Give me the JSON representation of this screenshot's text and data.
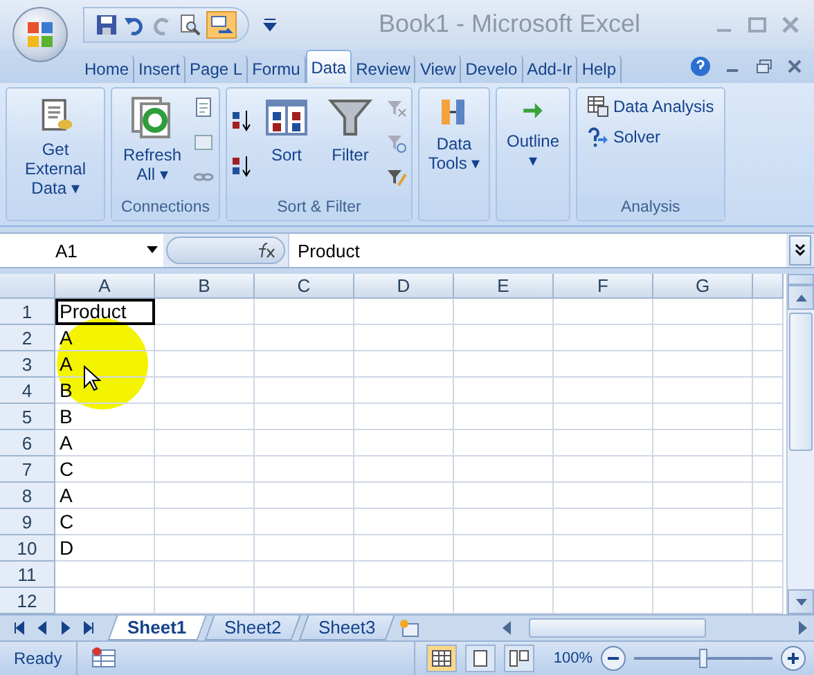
{
  "window": {
    "title": "Book1 - Microsoft Excel"
  },
  "tabs": [
    {
      "label": "Home",
      "selected": false
    },
    {
      "label": "Insert",
      "selected": false
    },
    {
      "label": "Page L",
      "selected": false
    },
    {
      "label": "Formu",
      "selected": false
    },
    {
      "label": "Data",
      "selected": true
    },
    {
      "label": "Review",
      "selected": false
    },
    {
      "label": "View",
      "selected": false
    },
    {
      "label": "Develo",
      "selected": false
    },
    {
      "label": "Add-Ir",
      "selected": false
    },
    {
      "label": "Help",
      "selected": false
    }
  ],
  "ribbon_groups": [
    {
      "buttons": [
        {
          "kind": "large",
          "label": "Get External Data ▾"
        }
      ]
    },
    {
      "label": "Connections",
      "buttons": [
        {
          "kind": "large",
          "label": "Refresh All ▾"
        },
        {
          "kind": "stack"
        }
      ]
    },
    {
      "label": "Sort & Filter",
      "buttons": [
        {
          "kind": "sortpair"
        },
        {
          "kind": "large",
          "label": "Sort"
        },
        {
          "kind": "large",
          "label": "Filter"
        },
        {
          "kind": "stack"
        }
      ]
    },
    {
      "buttons": [
        {
          "kind": "large",
          "label": "Data Tools ▾"
        }
      ]
    },
    {
      "buttons": [
        {
          "kind": "large",
          "label": "Outline ▾"
        }
      ]
    },
    {
      "label": "Analysis",
      "buttons": [
        {
          "kind": "small",
          "label": "Data Analysis"
        },
        {
          "kind": "small",
          "label": "Solver"
        }
      ]
    }
  ],
  "formula_bar": {
    "name_box": "A1",
    "formula": "Product"
  },
  "columns": [
    "A",
    "B",
    "C",
    "D",
    "E",
    "F",
    "G"
  ],
  "rows": [
    {
      "header": "1",
      "value": "Product",
      "selected": true
    },
    {
      "header": "2",
      "value": "A",
      "selected": false
    },
    {
      "header": "3",
      "value": "A",
      "selected": false
    },
    {
      "header": "4",
      "value": "B",
      "selected": false
    },
    {
      "header": "5",
      "value": "B",
      "selected": false
    },
    {
      "header": "6",
      "value": "A",
      "selected": false
    },
    {
      "header": "7",
      "value": "C",
      "selected": false
    },
    {
      "header": "8",
      "value": "A",
      "selected": false
    },
    {
      "header": "9",
      "value": "C",
      "selected": false
    },
    {
      "header": "10",
      "value": "D",
      "selected": false
    },
    {
      "header": "11",
      "selected": false
    },
    {
      "header": "12",
      "selected": false
    }
  ],
  "sheets": [
    {
      "label": "Sheet1",
      "selected": true
    },
    {
      "label": "Sheet2",
      "selected": false
    },
    {
      "label": "Sheet3",
      "selected": false
    }
  ],
  "status_bar": {
    "status": "Ready",
    "zoom": "100%",
    "level": 0.5
  }
}
